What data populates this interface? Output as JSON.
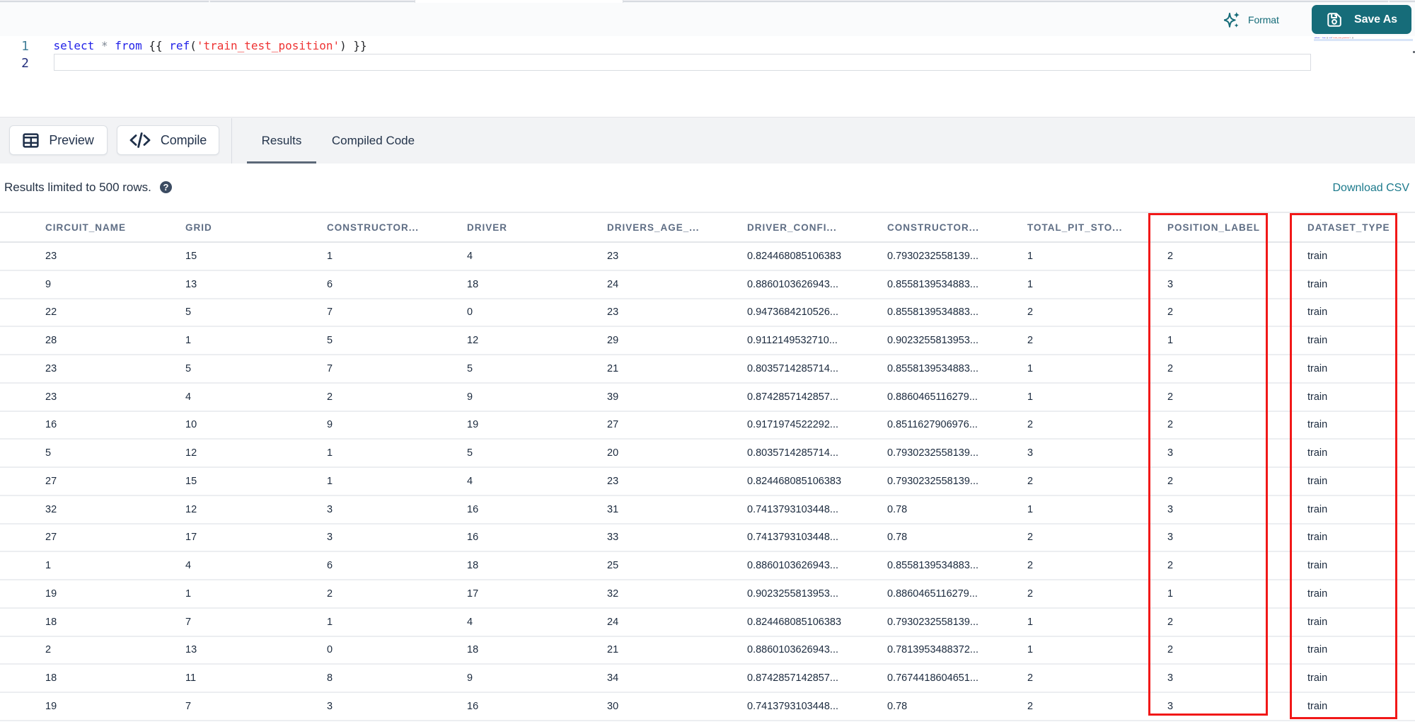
{
  "colors": {
    "teal": "#166c79",
    "annotation_red": "#f11818"
  },
  "editor_toolbar": {
    "format_label": "Format",
    "save_as_label": "Save As"
  },
  "editor": {
    "lines": [
      {
        "number": "1",
        "tokens": [
          {
            "t": "select",
            "c": "kw"
          },
          {
            "t": " ",
            "c": "plain"
          },
          {
            "t": "*",
            "c": "op"
          },
          {
            "t": " ",
            "c": "plain"
          },
          {
            "t": "from",
            "c": "kw"
          },
          {
            "t": " ",
            "c": "plain"
          },
          {
            "t": "{{",
            "c": "brace"
          },
          {
            "t": " ",
            "c": "plain"
          },
          {
            "t": "ref",
            "c": "fn"
          },
          {
            "t": "(",
            "c": "paren"
          },
          {
            "t": "'train_test_position'",
            "c": "str"
          },
          {
            "t": ")",
            "c": "paren"
          },
          {
            "t": " ",
            "c": "plain"
          },
          {
            "t": "}}",
            "c": "brace"
          }
        ]
      },
      {
        "number": "2",
        "tokens": []
      }
    ]
  },
  "action_bar": {
    "preview_label": "Preview",
    "compile_label": "Compile",
    "tabs": [
      {
        "label": "Results",
        "active": true
      },
      {
        "label": "Compiled Code",
        "active": false
      }
    ]
  },
  "results": {
    "limit_note": "Results limited to 500 rows.",
    "help_icon_glyph": "?",
    "download_csv_label": "Download CSV",
    "table": {
      "columns": [
        "CIRCUIT_NAME",
        "GRID",
        "CONSTRUCTOR...",
        "DRIVER",
        "DRIVERS_AGE_...",
        "DRIVER_CONFI...",
        "CONSTRUCTOR...",
        "TOTAL_PIT_STO...",
        "POSITION_LABEL",
        "DATASET_TYPE"
      ],
      "rows": [
        [
          "23",
          "15",
          "1",
          "4",
          "23",
          "0.824468085106383",
          "0.7930232558139...",
          "1",
          "2",
          "train"
        ],
        [
          "9",
          "13",
          "6",
          "18",
          "24",
          "0.8860103626943...",
          "0.8558139534883...",
          "1",
          "3",
          "train"
        ],
        [
          "22",
          "5",
          "7",
          "0",
          "23",
          "0.9473684210526...",
          "0.8558139534883...",
          "2",
          "2",
          "train"
        ],
        [
          "28",
          "1",
          "5",
          "12",
          "29",
          "0.9112149532710...",
          "0.9023255813953...",
          "2",
          "1",
          "train"
        ],
        [
          "23",
          "5",
          "7",
          "5",
          "21",
          "0.8035714285714...",
          "0.8558139534883...",
          "1",
          "2",
          "train"
        ],
        [
          "23",
          "4",
          "2",
          "9",
          "39",
          "0.8742857142857...",
          "0.8860465116279...",
          "1",
          "2",
          "train"
        ],
        [
          "16",
          "10",
          "9",
          "19",
          "27",
          "0.9171974522292...",
          "0.8511627906976...",
          "2",
          "2",
          "train"
        ],
        [
          "5",
          "12",
          "1",
          "5",
          "20",
          "0.8035714285714...",
          "0.7930232558139...",
          "3",
          "3",
          "train"
        ],
        [
          "27",
          "15",
          "1",
          "4",
          "23",
          "0.824468085106383",
          "0.7930232558139...",
          "2",
          "2",
          "train"
        ],
        [
          "32",
          "12",
          "3",
          "16",
          "31",
          "0.7413793103448...",
          "0.78",
          "1",
          "3",
          "train"
        ],
        [
          "27",
          "17",
          "3",
          "16",
          "33",
          "0.7413793103448...",
          "0.78",
          "2",
          "3",
          "train"
        ],
        [
          "1",
          "4",
          "6",
          "18",
          "25",
          "0.8860103626943...",
          "0.8558139534883...",
          "2",
          "2",
          "train"
        ],
        [
          "19",
          "1",
          "2",
          "17",
          "32",
          "0.9023255813953...",
          "0.8860465116279...",
          "2",
          "1",
          "train"
        ],
        [
          "18",
          "7",
          "1",
          "4",
          "24",
          "0.824468085106383",
          "0.7930232558139...",
          "1",
          "2",
          "train"
        ],
        [
          "2",
          "13",
          "0",
          "18",
          "21",
          "0.8860103626943...",
          "0.7813953488372...",
          "1",
          "2",
          "train"
        ],
        [
          "18",
          "11",
          "8",
          "9",
          "34",
          "0.8742857142857...",
          "0.7674418604651...",
          "2",
          "3",
          "train"
        ],
        [
          "19",
          "7",
          "3",
          "16",
          "30",
          "0.7413793103448...",
          "0.78",
          "2",
          "3",
          "train"
        ]
      ],
      "annotated_columns": [
        "POSITION_LABEL",
        "DATASET_TYPE"
      ]
    }
  }
}
